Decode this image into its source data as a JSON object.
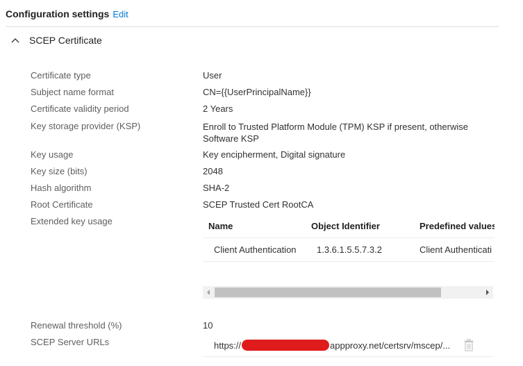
{
  "header": {
    "title": "Configuration settings",
    "edit_label": "Edit"
  },
  "section": {
    "label": "SCEP Certificate",
    "icon": "chevron-up-icon"
  },
  "fields": {
    "certificate_type": {
      "label": "Certificate type",
      "value": "User"
    },
    "subject_name_format": {
      "label": "Subject name format",
      "value": "CN={{UserPrincipalName}}"
    },
    "validity_period": {
      "label": "Certificate validity period",
      "value": "2 Years"
    },
    "ksp": {
      "label": "Key storage provider (KSP)",
      "value": "Enroll to Trusted Platform Module (TPM) KSP if present, otherwise Software KSP"
    },
    "key_usage": {
      "label": "Key usage",
      "value": "Key encipherment, Digital signature"
    },
    "key_size": {
      "label": "Key size (bits)",
      "value": "2048"
    },
    "hash_algorithm": {
      "label": "Hash algorithm",
      "value": "SHA-2"
    },
    "root_certificate": {
      "label": "Root Certificate",
      "value": "SCEP Trusted Cert RootCA"
    },
    "extended_key_usage": {
      "label": "Extended key usage"
    },
    "renewal_threshold": {
      "label": "Renewal threshold (%)",
      "value": "10"
    },
    "scep_server_urls": {
      "label": "SCEP Server URLs"
    }
  },
  "eku_table": {
    "columns": [
      "Name",
      "Object Identifier",
      "Predefined values"
    ],
    "rows": [
      {
        "name": "Client Authentication",
        "oid": "1.3.6.1.5.5.7.3.2",
        "predefined": "Client Authenticati"
      }
    ]
  },
  "scep_url": {
    "prefix": "https://",
    "suffix": "appproxy.net/certsrv/mscep/...",
    "delete_icon": "trash-icon"
  },
  "colors": {
    "accent": "#0078d4",
    "redaction": "#e01b1b"
  }
}
